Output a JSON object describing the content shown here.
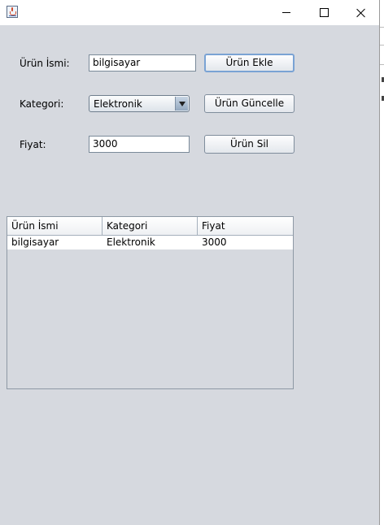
{
  "form": {
    "name_label": "Ürün İsmi:",
    "name_value": "bilgisayar",
    "category_label": "Kategori:",
    "category_value": "Elektronik",
    "price_label": "Fiyat:",
    "price_value": "3000"
  },
  "buttons": {
    "add": "Ürün Ekle",
    "update": "Ürün Güncelle",
    "delete": "Ürün Sil"
  },
  "table": {
    "columns": [
      "Ürün İsmi",
      "Kategori",
      "Fiyat"
    ],
    "rows": [
      [
        "bilgisayar",
        "Elektronik",
        "3000"
      ]
    ]
  },
  "titlebar": {
    "icons": [
      "java-app-icon",
      "minimize-icon",
      "maximize-icon",
      "close-icon"
    ]
  }
}
